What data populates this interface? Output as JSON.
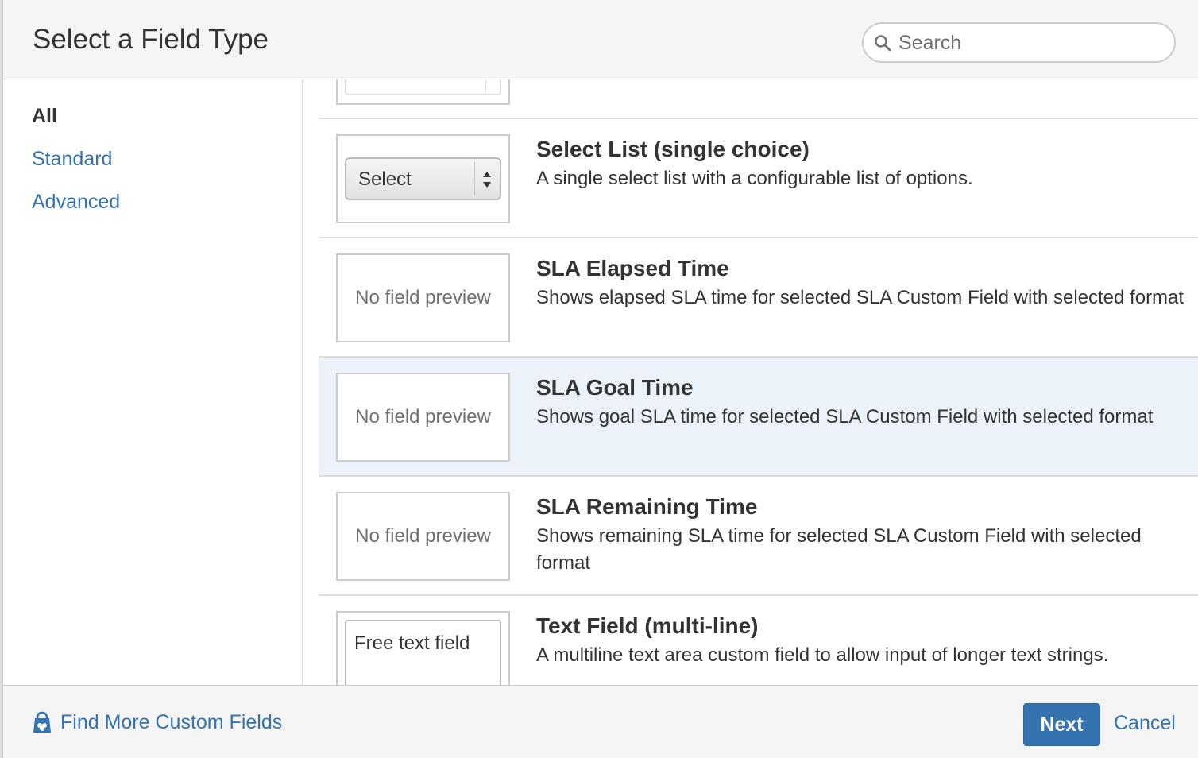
{
  "dialog": {
    "title": "Select a Field Type"
  },
  "search": {
    "placeholder": "Search",
    "icon": "search-icon"
  },
  "sidebar": {
    "items": [
      {
        "label": "All",
        "active": true
      },
      {
        "label": "Standard",
        "active": false
      },
      {
        "label": "Advanced",
        "active": false
      }
    ]
  },
  "field_types": [
    {
      "title": "Select List (single choice)",
      "description": "A single select list with a configurable list of options.",
      "preview": {
        "kind": "select",
        "label": "Select"
      },
      "selected": false
    },
    {
      "title": "SLA Elapsed Time",
      "description": "Shows elapsed SLA time for selected SLA Custom Field with selected format",
      "preview": {
        "kind": "none",
        "label": "No field preview"
      },
      "selected": false
    },
    {
      "title": "SLA Goal Time",
      "description": "Shows goal SLA time for selected SLA Custom Field with selected format",
      "preview": {
        "kind": "none",
        "label": "No field preview"
      },
      "selected": true
    },
    {
      "title": "SLA Remaining Time",
      "description": "Shows remaining SLA time for selected SLA Custom Field with selected format",
      "preview": {
        "kind": "none",
        "label": "No field preview"
      },
      "selected": false
    },
    {
      "title": "Text Field (multi-line)",
      "description": "A multiline text area custom field to allow input of longer text strings.",
      "preview": {
        "kind": "textarea",
        "label": "Free text field"
      },
      "selected": false
    }
  ],
  "footer": {
    "find_more_label": "Find More Custom Fields",
    "find_more_icon": "marketplace-bag-icon",
    "next_label": "Next",
    "cancel_label": "Cancel"
  },
  "colors": {
    "link": "#3572b0",
    "primary_button": "#3572b0",
    "selected_row": "#ebf2f9",
    "header_bg": "#f5f5f5"
  }
}
